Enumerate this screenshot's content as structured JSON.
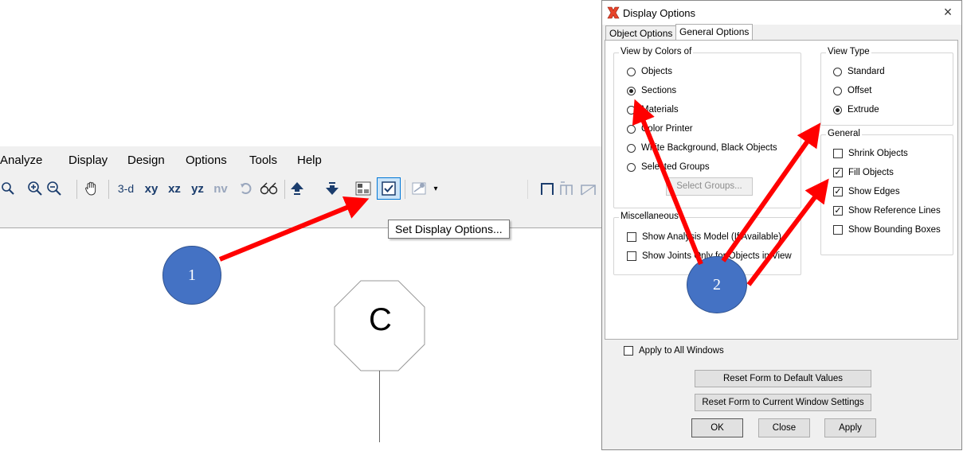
{
  "app": {
    "menu": [
      "Analyze",
      "Display",
      "Design",
      "Options",
      "Tools",
      "Help"
    ],
    "toolbar": {
      "view_3d": "3-d",
      "view_xy": "xy",
      "view_xz": "xz",
      "view_yz": "yz",
      "view_nv": "nv"
    },
    "tooltip": "Set Display Options...",
    "canvas": {
      "label_marker_text": "C"
    }
  },
  "callouts": {
    "one": "1",
    "two": "2"
  },
  "dialog": {
    "title": "Display Options",
    "close_glyph": "×",
    "tabs": [
      "Object Options",
      "General Options"
    ],
    "active_tab": "General Options",
    "view_by_colors": {
      "label": "View by Colors of",
      "options": [
        "Objects",
        "Sections",
        "Materials",
        "Color Printer",
        "White Background, Black Objects",
        "Selected Groups"
      ],
      "selected": "Sections",
      "select_groups_button": "Select Groups..."
    },
    "view_type": {
      "label": "View Type",
      "options": [
        "Standard",
        "Offset",
        "Extrude"
      ],
      "selected": "Extrude"
    },
    "general": {
      "label": "General",
      "items": [
        {
          "label": "Shrink Objects",
          "checked": false
        },
        {
          "label": "Fill Objects",
          "checked": true
        },
        {
          "label": "Show Edges",
          "checked": true
        },
        {
          "label": "Show Reference Lines",
          "checked": true
        },
        {
          "label": "Show Bounding Boxes",
          "checked": false
        }
      ]
    },
    "miscellaneous": {
      "label": "Miscellaneous",
      "items": [
        {
          "label": "Show Analysis Model (If Available)",
          "checked": false
        },
        {
          "label": "Show Joints Only for Objects in View",
          "checked": false
        }
      ]
    },
    "apply_to_all": {
      "label": "Apply to All Windows",
      "checked": false
    },
    "buttons": {
      "reset_default": "Reset Form to Default Values",
      "reset_current": "Reset Form to Current Window Settings",
      "ok": "OK",
      "close": "Close",
      "apply": "Apply"
    }
  },
  "colors": {
    "arrow": "#ff0000",
    "callout_fill": "#4472c4",
    "title_icon": "#e8432a"
  }
}
